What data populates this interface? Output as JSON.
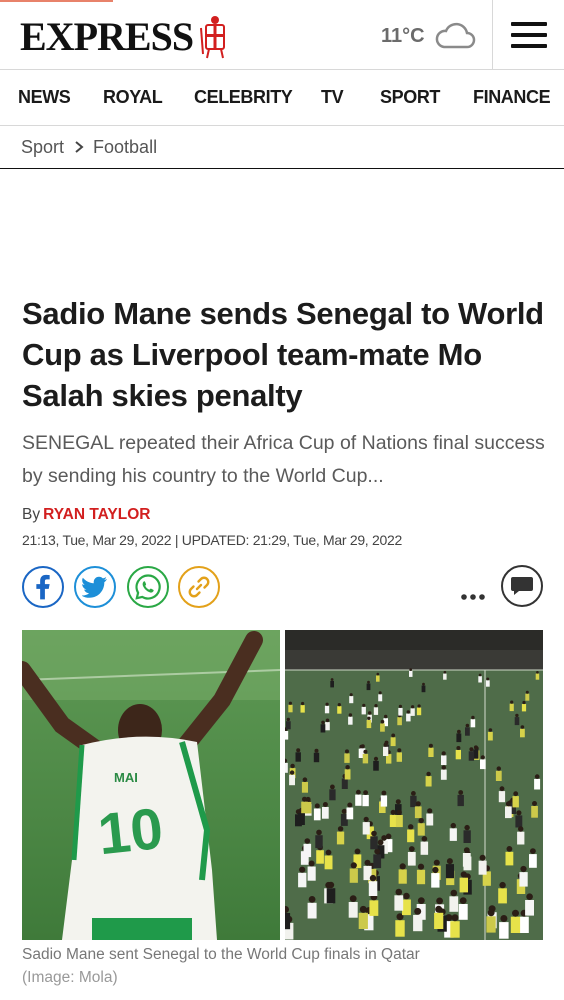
{
  "header": {
    "logo_text": "EXPRESS",
    "weather_temp": "11°C",
    "weather_icon": "cloud-icon",
    "menu_icon": "hamburger-icon",
    "reading_progress": 0.2
  },
  "nav": {
    "items": [
      {
        "label": "NEWS"
      },
      {
        "label": "ROYAL"
      },
      {
        "label": "CELEBRITY"
      },
      {
        "label": "TV"
      },
      {
        "label": "SPORT"
      },
      {
        "label": "FINANCE"
      }
    ]
  },
  "breadcrumb": {
    "items": [
      "Sport",
      "Football"
    ],
    "separator_icon": "chevron-right-icon"
  },
  "article": {
    "headline": "Sadio Mane sends Senegal to World Cup as Liverpool team-mate Mo Salah skies penalty",
    "standfirst": "SENEGAL repeated their Africa Cup of Nations final success by sending his country to the World Cup...",
    "byline_prefix": "By",
    "author": "RYAN TAYLOR",
    "dateline": "21:13, Tue, Mar 29, 2022 | UPDATED: 21:29, Tue, Mar 29, 2022",
    "share_icons": [
      "facebook-icon",
      "twitter-icon",
      "whatsapp-icon",
      "link-icon",
      "more-icon",
      "comment-icon"
    ],
    "image": {
      "caption": "Sadio Mane sent Senegal to the World Cup finals in Qatar",
      "credit": "(Image: Mola)",
      "shirt_name": "MAI",
      "shirt_number": "10"
    }
  },
  "colors": {
    "accent_red": "#d21f1f",
    "facebook": "#1a66c4",
    "twitter": "#1d8fd8",
    "whatsapp": "#2aa845",
    "link": "#e3a11a",
    "progress": "#e8826a"
  }
}
